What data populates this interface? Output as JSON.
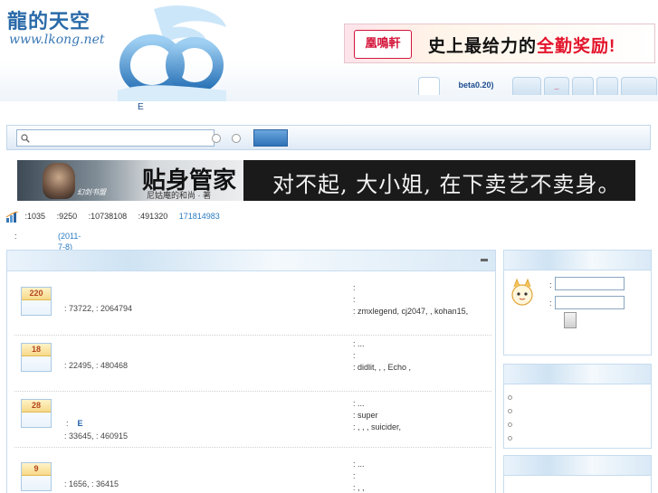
{
  "header": {
    "logo_title": "龍的天空",
    "logo_url": "www.lkong.net",
    "ad_logo_text": "凰鳴軒",
    "ad_text_prefix": "史上最给力的",
    "ad_text_highlight": "全勤奖励!"
  },
  "nav": {
    "tabs": [
      "",
      "beta0.20)",
      "",
      "_",
      "",
      "",
      ""
    ],
    "sub_label": "E"
  },
  "search": {
    "placeholder": ""
  },
  "novel_banner": {
    "title": "贴身管家",
    "author": "尼姑庵的和尚 · 著",
    "tagline": "对不起, 大小姐, 在下卖艺不卖身。",
    "logo_small": "幻剑书盟"
  },
  "stats": {
    "items": [
      ":1035",
      ":9250",
      ":10738108",
      ":491320"
    ],
    "link": "171814983"
  },
  "announcement": {
    "label": ":",
    "date": "(2011-7-8)"
  },
  "forum": {
    "collapse_icon": "collapse-icon",
    "rows": [
      {
        "badge": "220",
        "sub": "",
        "sub_e": "",
        "stat": ": 73722, : 2064794",
        "right": [
          ":",
          ":",
          ": zmxlegend, cj2047, , kohan15,"
        ]
      },
      {
        "badge": "18",
        "sub": "",
        "sub_e": "",
        "stat": ": 22495, : 480468",
        "right": [
          ":          ...",
          ":",
          ": didlit, , , Echo ,"
        ]
      },
      {
        "badge": "28",
        "sub": ":",
        "sub_e": "E",
        "stat": ": 33645, : 460915",
        "right": [
          ":          ...",
          ": super",
          ": , , , suicider,"
        ]
      },
      {
        "badge": "9",
        "sub": "",
        "sub_e": "",
        "stat": ": 1656, : 36415",
        "right": [
          ":          ...",
          ":",
          ": , ,"
        ]
      }
    ]
  },
  "sidebar": {
    "login_user_label": ":",
    "login_pass_label": ":",
    "bullets": [
      "",
      "",
      "",
      ""
    ]
  }
}
